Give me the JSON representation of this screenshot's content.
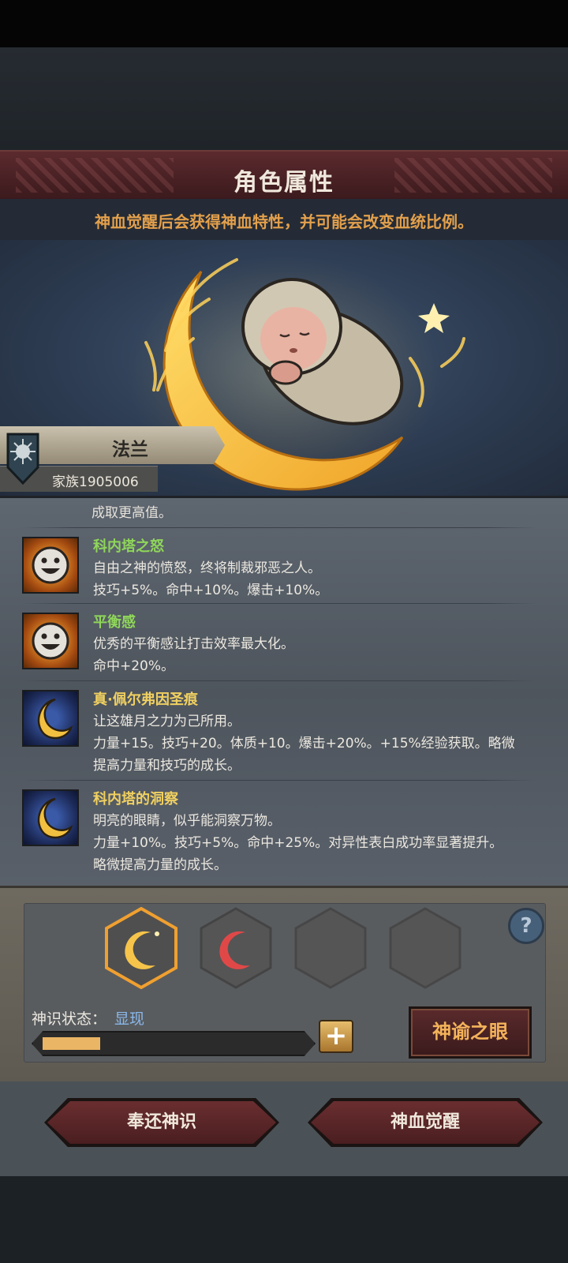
{
  "header": {
    "title": "角色属性",
    "subtitle": "神血觉醒后会获得神血特性，并可能会改变血统比例。"
  },
  "character": {
    "name": "法兰",
    "family": "家族1905006"
  },
  "traits_cut_text": "成取更高值。",
  "traits": [
    {
      "name": "科内塔之怒",
      "name_color": "#8fd65a",
      "icon": "smiley-face-icon",
      "line1": "自由之神的愤怒，终将制裁邪恶之人。",
      "line2": "技巧+5%。命中+10%。爆击+10%。"
    },
    {
      "name": "平衡感",
      "name_color": "#8fd65a",
      "icon": "smiley-face-icon",
      "line1": "优秀的平衡感让打击效率最大化。",
      "line2": "命中+20%。"
    },
    {
      "name": "真·佩尔弗因圣痕",
      "name_color": "#f0d060",
      "icon": "crescent-moon-icon",
      "line1": "让这雄月之力为己所用。",
      "line2": "力量+15。技巧+20。体质+10。爆击+20%。+15%经验获取。略微",
      "line3": "提高力量和技巧的成长。"
    },
    {
      "name": "科内塔的洞察",
      "name_color": "#f0d060",
      "icon": "crescent-moon-icon",
      "line1": "明亮的眼睛，似乎能洞察万物。",
      "line2": "力量+10%。技巧+5%。命中+25%。对异性表白成功率显著提升。",
      "line3": "略微提高力量的成长。"
    }
  ],
  "divine": {
    "state_label": "神识状态：",
    "state_value": "显现",
    "progress": 0.22,
    "oracle_button": "神谕之眼",
    "help_label": "?",
    "plus_label": "+"
  },
  "actions": {
    "return_label": "奉还神识",
    "awaken_label": "神血觉醒"
  },
  "colors": {
    "accent_gold": "#e3a04c",
    "title_red": "#5b2a2e",
    "state_blue": "#8ab8ea"
  }
}
